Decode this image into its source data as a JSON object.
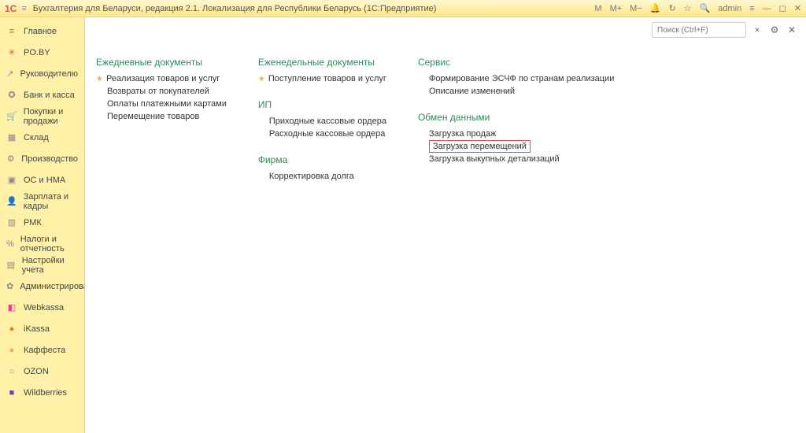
{
  "titlebar": {
    "logo": "1С",
    "title": "Бухгалтерия для Беларуси, редакция 2.1. Локализация для Республики Беларусь  (1С:Предприятие)",
    "m": "M",
    "mplus": "M+",
    "mminus": "M−",
    "user": "admin"
  },
  "search": {
    "placeholder": "Поиск (Ctrl+F)",
    "clear": "×"
  },
  "sidebar": [
    {
      "label": "Главное",
      "icon": "≡",
      "cls": "c-grey"
    },
    {
      "label": "PO.BY",
      "icon": "✳",
      "cls": "c-red"
    },
    {
      "label": "Руководителю",
      "icon": "↗",
      "cls": "c-grey"
    },
    {
      "label": "Банк и касса",
      "icon": "✪",
      "cls": "c-grey"
    },
    {
      "label": "Покупки и продажи",
      "icon": "🛒",
      "cls": "c-grey"
    },
    {
      "label": "Склад",
      "icon": "▦",
      "cls": "c-grey"
    },
    {
      "label": "Производство",
      "icon": "⚙",
      "cls": "c-grey"
    },
    {
      "label": "ОС и НМА",
      "icon": "▣",
      "cls": "c-grey"
    },
    {
      "label": "Зарплата и кадры",
      "icon": "👤",
      "cls": "c-grey"
    },
    {
      "label": "РМК",
      "icon": "▥",
      "cls": "c-grey"
    },
    {
      "label": "Налоги и отчетность",
      "icon": "%",
      "cls": "c-grey"
    },
    {
      "label": "Настройки учета",
      "icon": "▤",
      "cls": "c-grey"
    },
    {
      "label": "Администрирование",
      "icon": "✿",
      "cls": "c-grey"
    },
    {
      "label": "Webkassa",
      "icon": "◧",
      "cls": "c-pink"
    },
    {
      "label": "iKassa",
      "icon": "●",
      "cls": "c-orange"
    },
    {
      "label": "Каффеста",
      "icon": "●",
      "cls": "c-yellow"
    },
    {
      "label": "OZON",
      "icon": "○",
      "cls": "c-grey"
    },
    {
      "label": "Wildberries",
      "icon": "■",
      "cls": "c-purple"
    }
  ],
  "content": {
    "col1": {
      "title": "Ежедневные документы",
      "items": [
        {
          "label": "Реализация товаров и услуг",
          "star": true
        },
        {
          "label": "Возвраты от покупателей"
        },
        {
          "label": "Оплаты платежными картами"
        },
        {
          "label": "Перемещение товаров"
        }
      ]
    },
    "col2": {
      "title": "Еженедельные документы",
      "items": [
        {
          "label": "Поступление товаров и услуг",
          "star": true
        }
      ],
      "title2": "ИП",
      "items2": [
        {
          "label": "Приходные кассовые ордера"
        },
        {
          "label": "Расходные кассовые ордера"
        }
      ],
      "title3": "Фирма",
      "items3": [
        {
          "label": "Корректировка долга"
        }
      ]
    },
    "col3": {
      "title": "Сервис",
      "items": [
        {
          "label": "Формирование ЭСЧФ по странам реализации"
        },
        {
          "label": "Описание изменений"
        }
      ],
      "title2": "Обмен данными",
      "items2": [
        {
          "label": "Загрузка продаж"
        },
        {
          "label": "Загрузка перемещений",
          "hl": true
        },
        {
          "label": "Загрузка выкупных детализаций"
        }
      ]
    }
  }
}
